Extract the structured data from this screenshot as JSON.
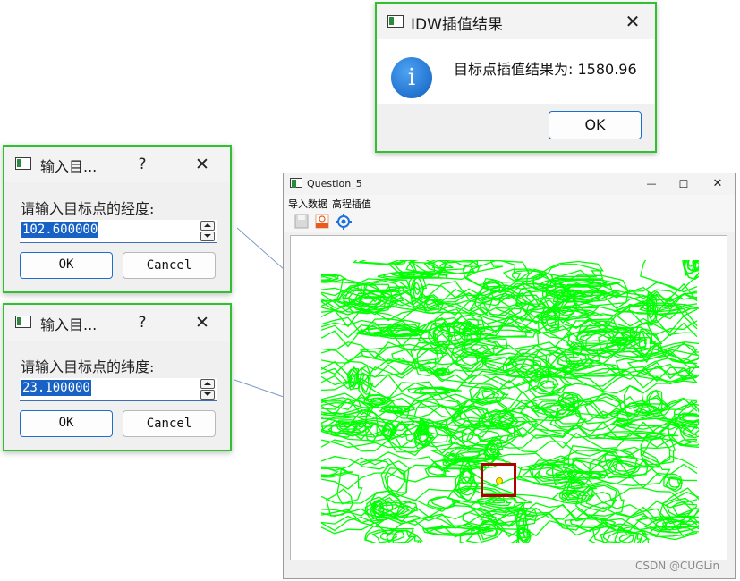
{
  "idw_dialog": {
    "title": "IDW插值结果",
    "message": "目标点插值结果为: 1580.96",
    "info_glyph": "i",
    "ok_label": "OK",
    "close_glyph": "✕",
    "icon": "info-icon"
  },
  "lon_dialog": {
    "title": "输入目...",
    "help_glyph": "?",
    "close_glyph": "✕",
    "prompt": "请输入目标点的经度:",
    "value": "102.600000",
    "ok_label": "OK",
    "cancel_label": "Cancel"
  },
  "lat_dialog": {
    "title": "输入目...",
    "help_glyph": "?",
    "close_glyph": "✕",
    "prompt": "请输入目标点的纬度:",
    "value": "23.100000",
    "ok_label": "OK",
    "cancel_label": "Cancel"
  },
  "main_window": {
    "title": "Question_5",
    "minimize_glyph": "—",
    "maximize_glyph": "☐",
    "close_glyph": "✕",
    "menu": [
      "导入数据",
      "高程插值"
    ],
    "toolbar_icons": [
      "save-icon",
      "import-data-icon",
      "locate-target-icon"
    ]
  },
  "colors": {
    "contour": "#00ff00",
    "target_box": "#b00000",
    "target_point": "#ffee00",
    "dialog_border": "#2fc12f",
    "accent": "#1762c4"
  },
  "watermark": "CSDN @CUGLin"
}
